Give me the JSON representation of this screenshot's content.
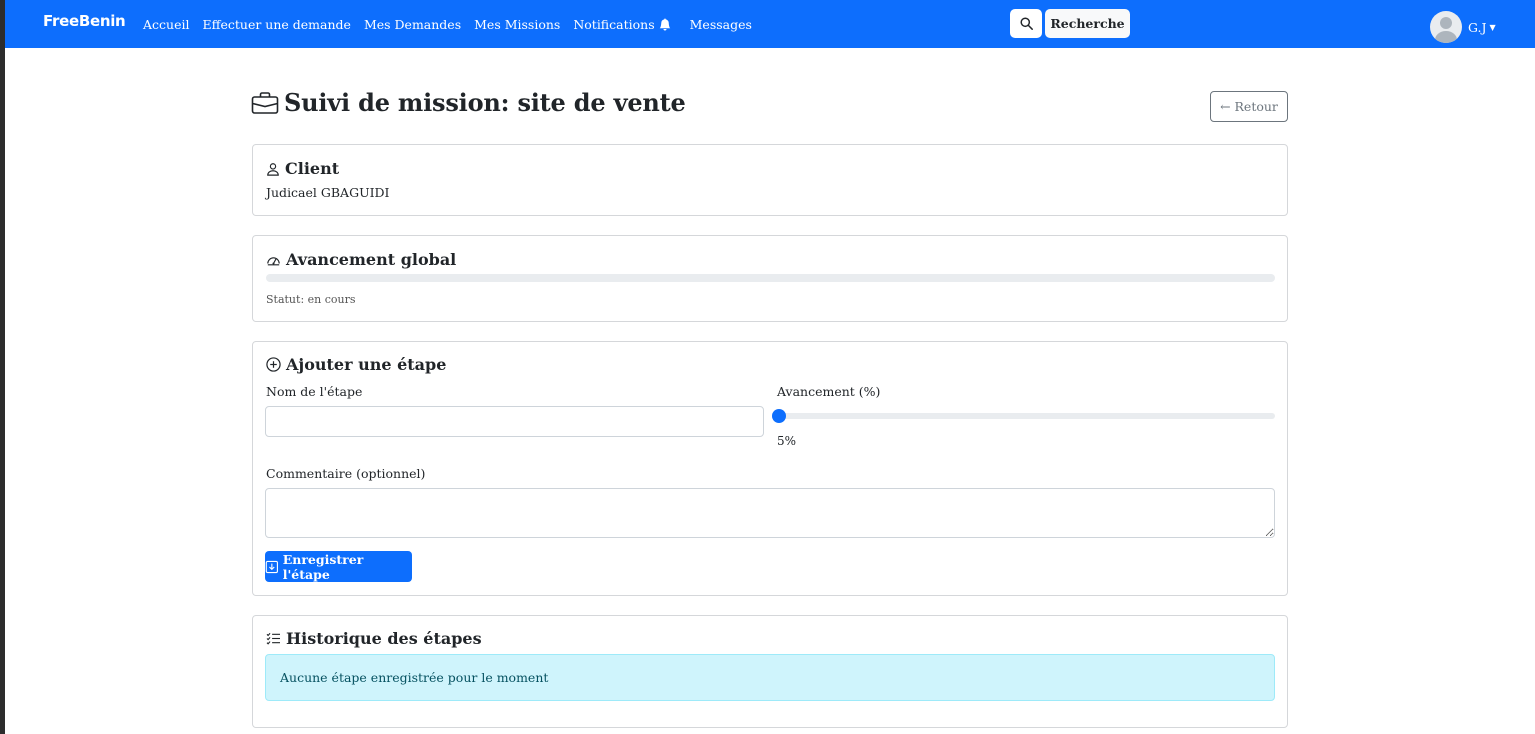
{
  "navbar": {
    "brand": "FreeBenin",
    "links": [
      "Accueil",
      "Effectuer une demande",
      "Mes Demandes",
      "Mes Missions",
      "Notifications",
      "Messages"
    ],
    "search_button_label": "Recherche",
    "user_initials": "G.J",
    "brand_color": "#0d6efd"
  },
  "header": {
    "title": "Suivi de mission: site de vente",
    "back_label": "← Retour"
  },
  "client_card": {
    "title": "Client",
    "name": "Judicael GBAGUIDI"
  },
  "progress_card": {
    "title": "Avancement global",
    "progress_percent": 0,
    "status_text": "Statut: en cours"
  },
  "add_step_card": {
    "title": "Ajouter une étape",
    "name_label": "Nom de l'étape",
    "name_value": "",
    "progress_label": "Avancement (%)",
    "progress_value_percent": 5,
    "progress_value_text": "5%",
    "comment_label": "Commentaire (optionnel)",
    "comment_value": "",
    "save_label": "Enregistrer l'étape"
  },
  "history_card": {
    "title": "Historique des étapes",
    "empty_message": "Aucune étape enregistrée pour le moment"
  },
  "icons": {
    "title": "briefcase-icon",
    "client": "person-icon",
    "progress": "speedometer-icon",
    "add_step": "plus-circle-icon",
    "save": "download-icon",
    "history": "list-check-icon",
    "search": "search-icon",
    "notifications": "bell-icon"
  }
}
